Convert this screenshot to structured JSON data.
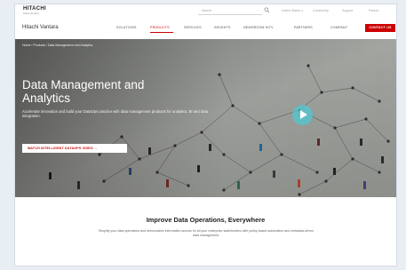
{
  "utility": {
    "logo": "HITACHI",
    "logo_tagline": "Inspire the Next",
    "search_placeholder": "Search",
    "links": [
      "United States ∨",
      "Community",
      "Support",
      "Partner"
    ]
  },
  "nav": {
    "brand": "Hitachi Vantara",
    "items": [
      {
        "label": "SOLUTIONS",
        "active": false
      },
      {
        "label": "PRODUCTS",
        "active": true
      },
      {
        "label": "SERVICES",
        "active": false
      },
      {
        "label": "INSIGHTS",
        "active": false
      },
      {
        "label": "NEWSROOM HITV",
        "active": false
      },
      {
        "label": "PARTNERS",
        "active": false
      },
      {
        "label": "COMPANY",
        "active": false
      }
    ],
    "contact_label": "CONTACT US"
  },
  "hero": {
    "breadcrumb": "Home  /  Products  /  Data Management and Analytics",
    "title": "Data Management and Analytics",
    "description": "Accelerate innovation and build your DataOps practice with data management products for analytics, BI and data integration.",
    "watch_label": "WATCH INTELLIGENT DATAOPS VIDEO  →",
    "play_icon": "play-icon"
  },
  "section": {
    "title": "Improve Data Operations, Everywhere",
    "body": "Simplify your data operations and democratize information access for all your enterprise stakeholders with policy-based automation and metadata-driven data management."
  },
  "colors": {
    "brand_red": "#cc0000",
    "hero_gray": "#8e8f8b",
    "play_teal": "#50c8d2"
  }
}
